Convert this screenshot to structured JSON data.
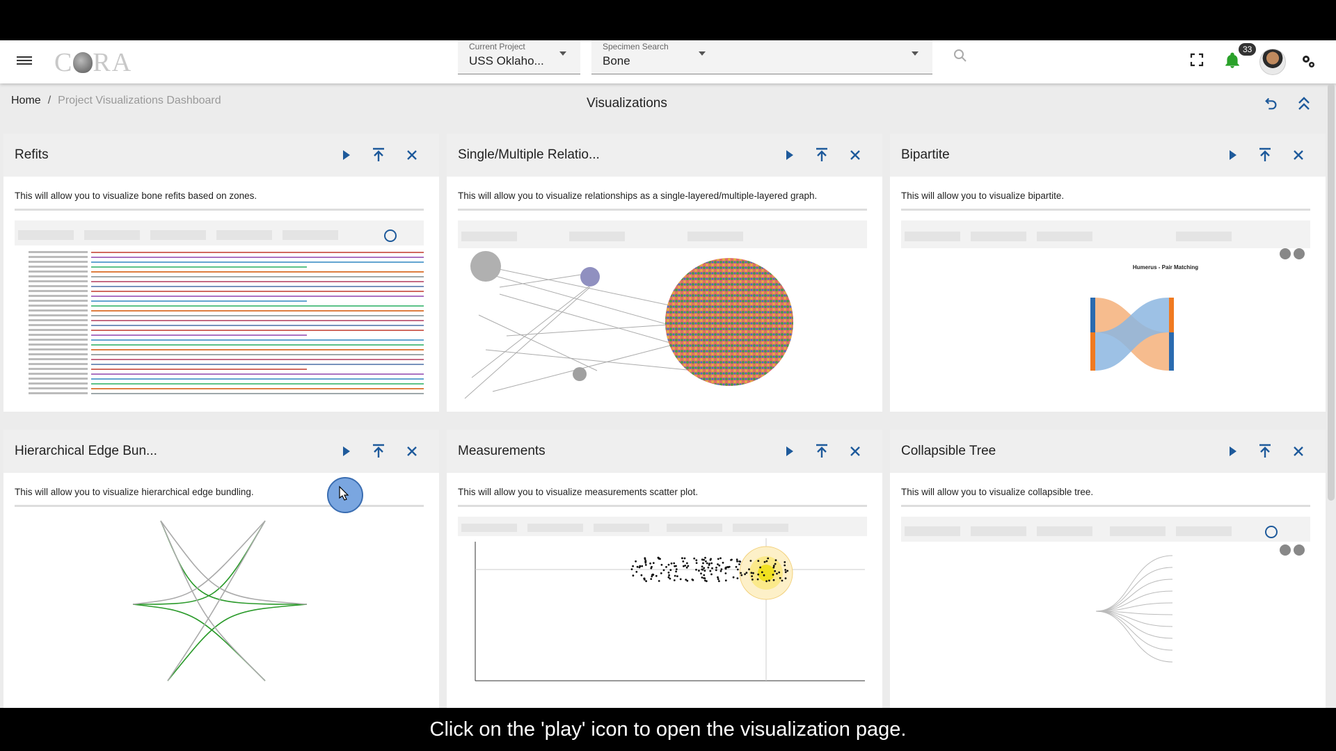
{
  "header": {
    "brand": "C RA",
    "current_project": {
      "label": "Current Project",
      "value": "USS Oklaho..."
    },
    "specimen_search": {
      "label": "Specimen Search",
      "value": "Bone"
    },
    "notification_count": "33"
  },
  "breadcrumb": {
    "home": "Home",
    "separator": "/",
    "current": "Project Visualizations Dashboard"
  },
  "page_title": "Visualizations",
  "cards": [
    {
      "title": "Refits",
      "description": "This will allow you to visualize bone refits based on zones."
    },
    {
      "title": "Single/Multiple Relatio...",
      "description": "This will allow you to visualize relationships as a single-layered/multiple-layered graph."
    },
    {
      "title": "Bipartite",
      "description": "This will allow you to visualize bipartite."
    },
    {
      "title": "Hierarchical Edge Bun...",
      "description": "This will allow you to visualize hierarchical edge bundling."
    },
    {
      "title": "Measurements",
      "description": "This will allow you to visualize measurements scatter plot."
    },
    {
      "title": "Collapsible Tree",
      "description": "This will allow you to visualize collapsible tree."
    }
  ],
  "thumbs": {
    "bipartite_title": "Humerus - Pair Matching"
  },
  "caption": "Click on the 'play' icon to open the visualization page.",
  "colors": {
    "accent": "#1e5a9b",
    "green": "#2aa12a",
    "bar_blue": "#6aa0d8",
    "bar_orange": "#f08a3c"
  }
}
